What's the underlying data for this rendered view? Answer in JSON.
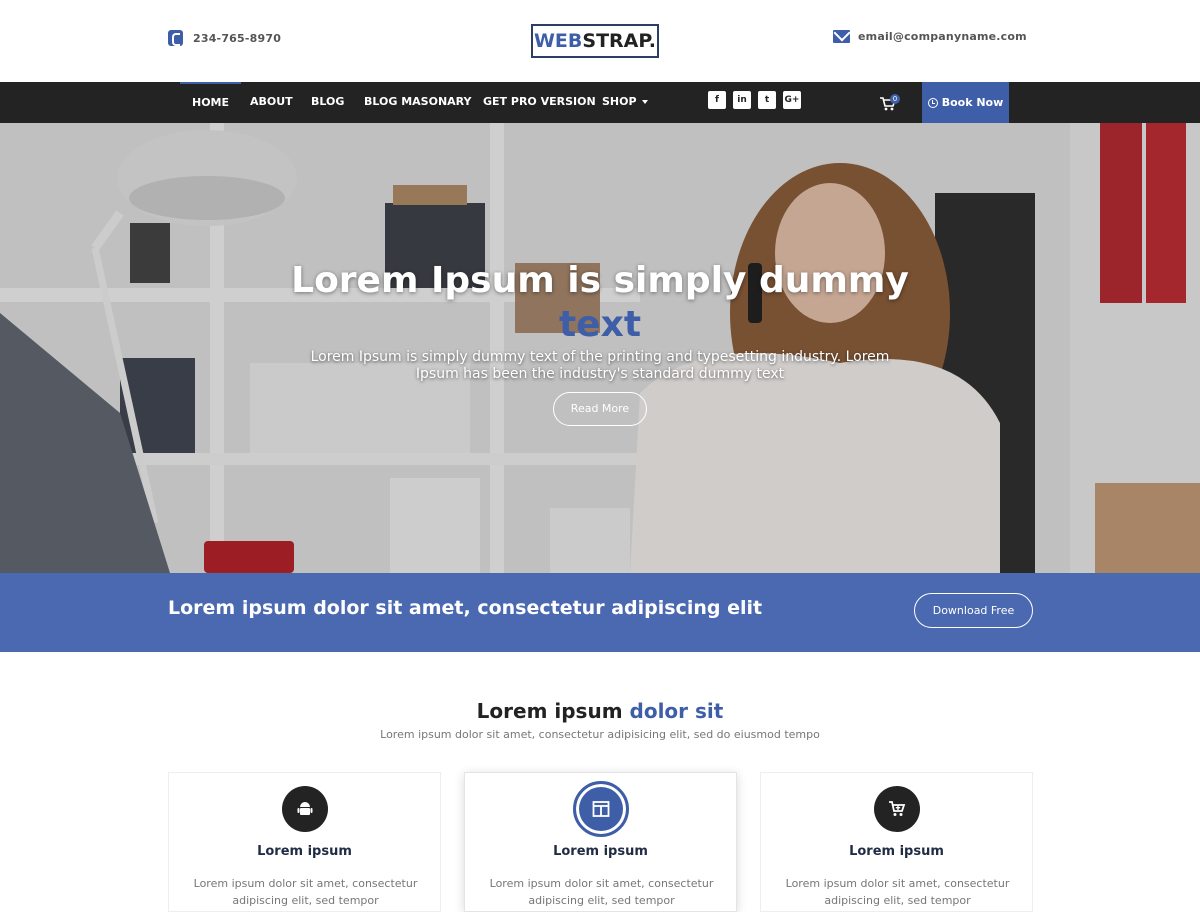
{
  "header": {
    "phone": "234-765-8970",
    "logo_part1": "WEB",
    "logo_part2": "STRAP.",
    "email": "email@companyname.com"
  },
  "nav": {
    "items": [
      "HOME",
      "ABOUT",
      "BLOG",
      "BLOG MASONARY",
      "GET PRO VERSION",
      "SHOP"
    ],
    "social": [
      "f",
      "in",
      "t",
      "G+"
    ],
    "cart_count": "0",
    "book_label": "Book Now"
  },
  "hero": {
    "title_line1": "Lorem Ipsum is simply dummy",
    "title_line2": "text",
    "subtitle": "Lorem Ipsum is simply dummy text of the printing and typesetting industry. Lorem Ipsum has been the industry's standard dummy text",
    "button": "Read More"
  },
  "band": {
    "text": "Lorem ipsum dolor sit amet, consectetur adipiscing elit",
    "button": "Download Free"
  },
  "section": {
    "title_plain": "Lorem ipsum ",
    "title_accent": "dolor sit",
    "subtitle": "Lorem ipsum dolor sit amet, consectetur adipisicing elit, sed do eiusmod tempo"
  },
  "cards": [
    {
      "icon": "android-icon",
      "title": "Lorem ipsum",
      "text": "Lorem ipsum dolor sit amet, consectetur adipiscing elit, sed tempor"
    },
    {
      "icon": "layout-icon",
      "title": "Lorem ipsum",
      "text": "Lorem ipsum dolor sit amet, consectetur adipiscing elit, sed tempor"
    },
    {
      "icon": "cart-plus-icon",
      "title": "Lorem ipsum",
      "text": "Lorem ipsum dolor sit amet, consectetur adipiscing elit, sed tempor"
    }
  ],
  "colors": {
    "accent": "#3e5ea8",
    "band": "#4a69b0",
    "nav": "#232323"
  }
}
